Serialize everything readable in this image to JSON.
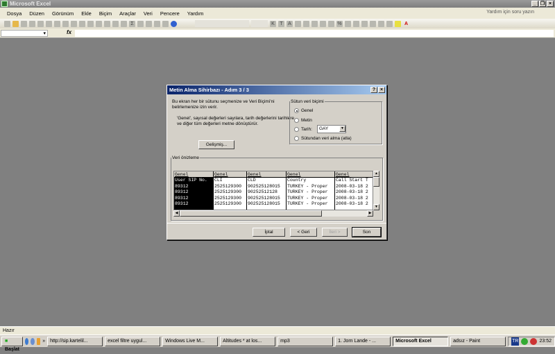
{
  "app": {
    "title": "Microsoft Excel",
    "help_placeholder": "Yardım için soru yazın"
  },
  "menu": [
    "Dosya",
    "Düzen",
    "Görünüm",
    "Ekle",
    "Biçim",
    "Araçlar",
    "Veri",
    "Pencere",
    "Yardım"
  ],
  "formula_bar": {
    "fx": "fx"
  },
  "dialog": {
    "title": "Metin Alma Sihirbazı - Adım 3 / 3",
    "help_btn": "?",
    "close_btn": "×",
    "intro": "Bu ekran her bir sütunu seçmenize ve Veri Biçimi'ni belirlemenize izin verir.",
    "note": "'Genel', sayısal değerleri sayılara, tarih değerlerini tarihlere ve diğer tüm değerleri metne dönüştürür.",
    "advanced_btn": "Gelişmiş...",
    "format_group": {
      "legend": "Sütun veri biçimi",
      "options": [
        "Genel",
        "Metin",
        "Tarih:",
        "Sütundan veri alma (atla)"
      ],
      "selected": "Genel",
      "date_format": "GAY"
    },
    "preview": {
      "legend": "Veri önizleme",
      "columns": [
        {
          "header": "Genel",
          "cells": [
            "User SIP No.",
            "89312",
            "89312",
            "89312",
            "89312"
          ]
        },
        {
          "header": "Genel",
          "cells": [
            "CLI",
            "2525129300",
            "2525129300",
            "2525129300",
            "2525129300"
          ]
        },
        {
          "header": "Genel",
          "cells": [
            "CLD",
            "902525128015",
            "90252512128",
            "902525128015",
            "902525128015"
          ]
        },
        {
          "header": "Genel",
          "cells": [
            "Country",
            "TURKEY - Proper",
            "TURKEY - Proper",
            "TURKEY - Proper",
            "TURKEY - Proper"
          ]
        },
        {
          "header": "Genel",
          "cells": [
            "Call Start T",
            "2008-03-18 2",
            "2008-03-18 2",
            "2008-03-18 2",
            "2008-03-18 2"
          ]
        }
      ]
    },
    "buttons": {
      "cancel": "İptal",
      "back": "< Geri",
      "next": "İleri >",
      "finish": "Son"
    }
  },
  "status": "Hazır",
  "taskbar": {
    "start": "Başlat",
    "chevron": "»",
    "tasks": [
      "http://sip.kartelil...",
      "excel filtre uygul...",
      "Windows Live M...",
      "Altitudes * at los...",
      "mp3",
      "1. Jorn Lande - ...",
      "Microsoft Excel",
      "adsız - Paint"
    ],
    "active": "Microsoft Excel",
    "lang": "TR",
    "clock": "23:52"
  }
}
